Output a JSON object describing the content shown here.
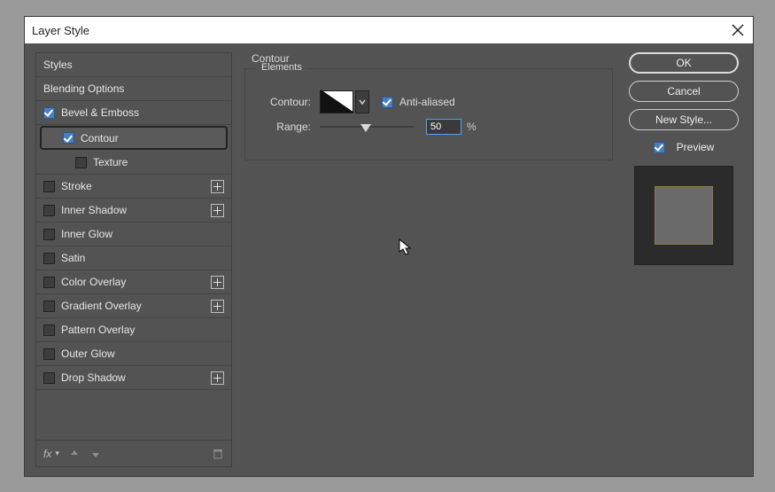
{
  "dialog": {
    "title": "Layer Style"
  },
  "left": {
    "styles_label": "Styles",
    "blending_label": "Blending Options",
    "items": [
      {
        "label": "Bevel & Emboss",
        "checked": true
      },
      {
        "label": "Contour",
        "checked": true
      },
      {
        "label": "Texture",
        "checked": false
      },
      {
        "label": "Stroke",
        "checked": false
      },
      {
        "label": "Inner Shadow",
        "checked": false
      },
      {
        "label": "Inner Glow",
        "checked": false
      },
      {
        "label": "Satin",
        "checked": false
      },
      {
        "label": "Color Overlay",
        "checked": false
      },
      {
        "label": "Gradient Overlay",
        "checked": false
      },
      {
        "label": "Pattern Overlay",
        "checked": false
      },
      {
        "label": "Outer Glow",
        "checked": false
      },
      {
        "label": "Drop Shadow",
        "checked": false
      }
    ],
    "fx_label": "fx"
  },
  "mid": {
    "panel_title": "Contour",
    "legend": "Elements",
    "contour_label": "Contour:",
    "antialiased_label": "Anti-aliased",
    "antialiased_checked": true,
    "range_label": "Range:",
    "range_value": "50",
    "range_unit": "%"
  },
  "right": {
    "ok": "OK",
    "cancel": "Cancel",
    "newstyle": "New Style...",
    "preview_label": "Preview",
    "preview_checked": true
  }
}
